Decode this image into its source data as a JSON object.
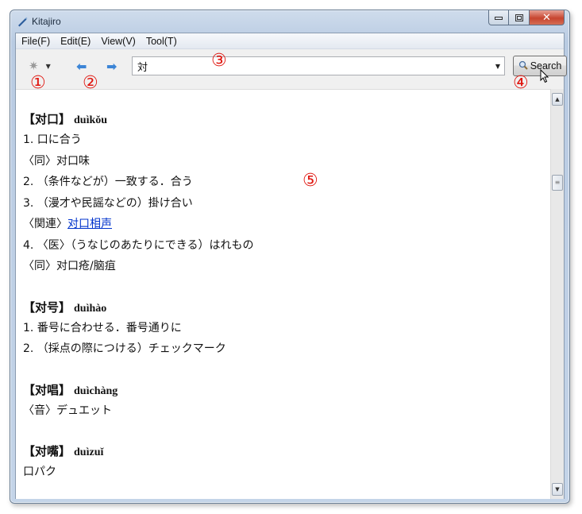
{
  "window": {
    "title": "Kitajiro"
  },
  "caption": {
    "minimize_glyph": "▭",
    "maximize_glyph": "▣",
    "close_glyph": "✕"
  },
  "menu": {
    "items": [
      "File(F)",
      "Edit(E)",
      "View(V)",
      "Tool(T)"
    ]
  },
  "toolbar": {
    "gear_icon": "gear-icon",
    "gear_glyph": "✷",
    "dropdown_glyph": "▼",
    "back_glyph": "⬅",
    "forward_glyph": "➡",
    "search_value": "対",
    "combo_arrow_glyph": "▼",
    "search_button_label": "Search",
    "search_icon_glyph": "🔍"
  },
  "markers": [
    "①",
    "②",
    "③",
    "④",
    "⑤"
  ],
  "entries": [
    {
      "head": "【对口】",
      "pinyin": "duìkǒu",
      "lines": [
        "1. 口に合う",
        "〈同〉对口味",
        "2. （条件などが）一致する．合う",
        "3. （漫才や民謡などの）掛け合い",
        "〈関連〉",
        "4. 〈医〉（うなじのあたりにできる）はれもの",
        "〈同〉对口疮/脑疽"
      ],
      "link_text": "对口相声"
    },
    {
      "head": "【对号】",
      "pinyin": "duìhào",
      "lines": [
        "1. 番号に合わせる．番号通りに",
        "2. （採点の際につける）チェックマーク"
      ]
    },
    {
      "head": "【对唱】",
      "pinyin": "duìchàng",
      "lines": [
        "〈音〉デュエット"
      ]
    },
    {
      "head": "【对嘴】",
      "pinyin": "duìzuǐ",
      "lines": [
        "口パク"
      ]
    }
  ],
  "scrollbar": {
    "up_glyph": "▲",
    "down_glyph": "▼",
    "thumb_glyph": "≡"
  },
  "colors": {
    "marker": "#e0160f",
    "link": "#0033cc",
    "nav_arrow": "#3c85d6"
  }
}
